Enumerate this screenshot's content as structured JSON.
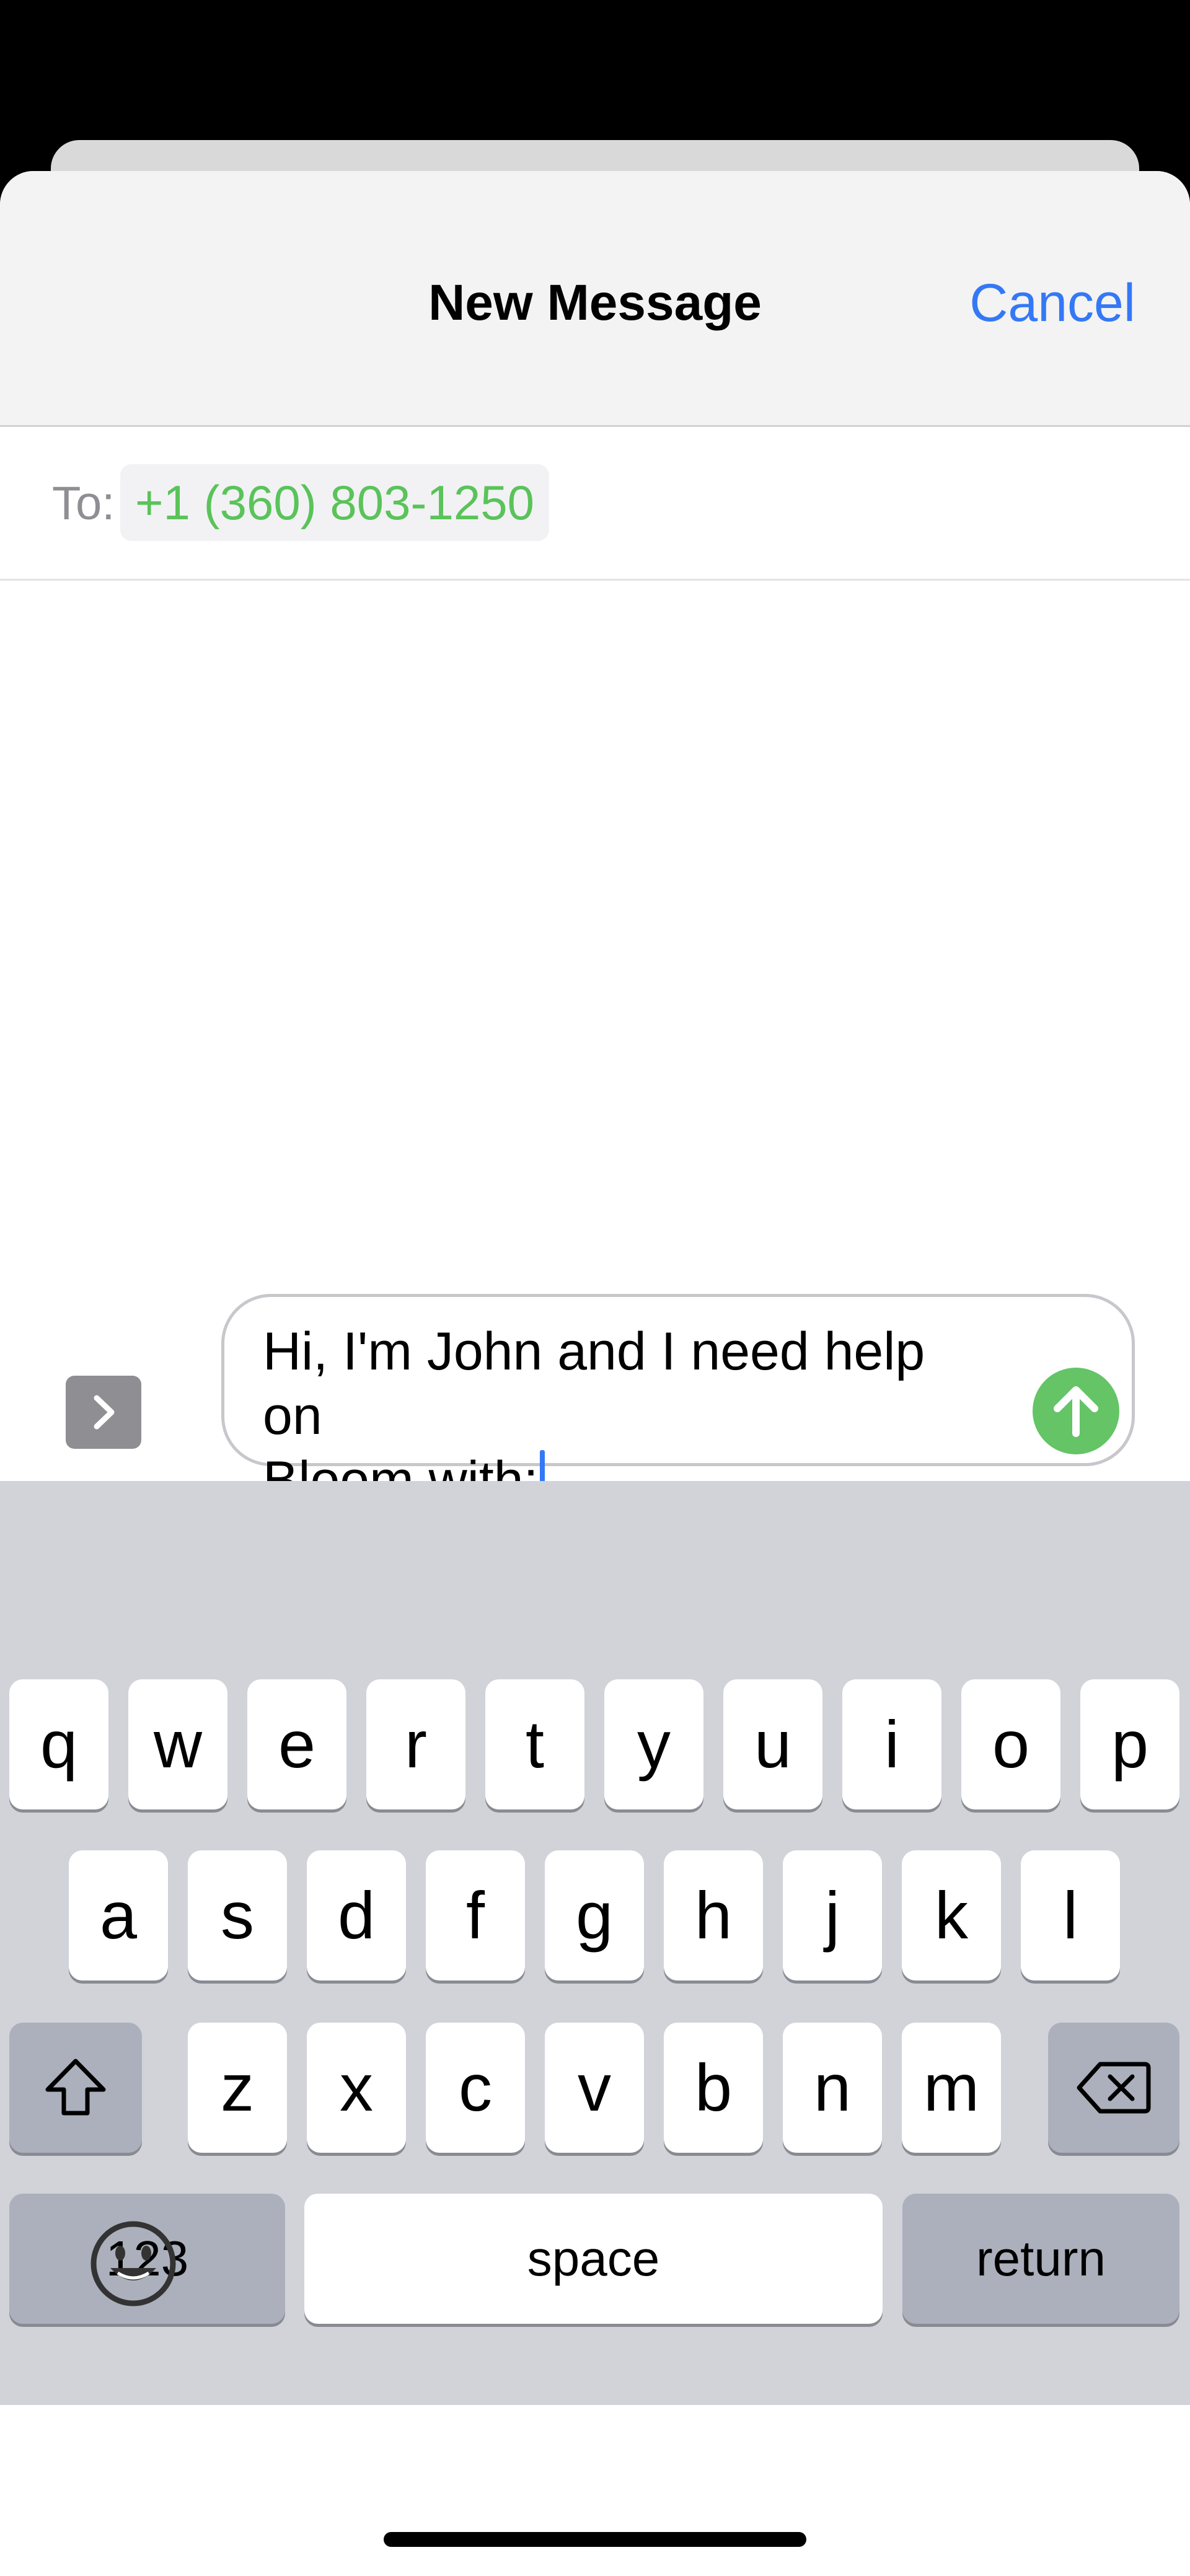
{
  "header": {
    "title": "New Message",
    "cancel_label": "Cancel"
  },
  "recipient": {
    "to_label": "To:",
    "value": "+1 (360) 803-1250"
  },
  "composer": {
    "line1": "Hi, I'm John and I need help on",
    "line2": "Bloom with:"
  },
  "keyboard": {
    "row1": [
      "q",
      "w",
      "e",
      "r",
      "t",
      "y",
      "u",
      "i",
      "o",
      "p"
    ],
    "row2": [
      "a",
      "s",
      "d",
      "f",
      "g",
      "h",
      "j",
      "k",
      "l"
    ],
    "row3": [
      "z",
      "x",
      "c",
      "v",
      "b",
      "n",
      "m"
    ],
    "numbers_label": "123",
    "space_label": "space",
    "return_label": "return"
  },
  "colors": {
    "accent_blue": "#3478f6",
    "send_green": "#64c466",
    "recipient_green": "#5ac35a",
    "keyboard_bg": "#d1d3d9"
  },
  "icons": {
    "expand": "chevron-right-icon",
    "send": "arrow-up-icon",
    "shift": "shift-icon",
    "backspace": "backspace-icon",
    "emoji": "emoji-icon"
  }
}
